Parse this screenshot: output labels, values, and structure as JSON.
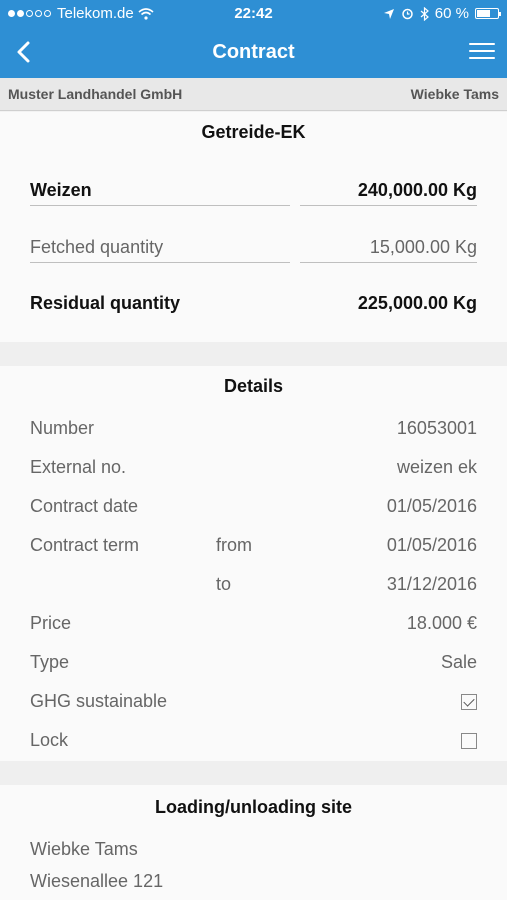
{
  "status": {
    "carrier": "Telekom.de",
    "time": "22:42",
    "battery": "60 %"
  },
  "nav": {
    "title": "Contract"
  },
  "customer": {
    "company": "Muster Landhandel GmbH",
    "person": "Wiebke Tams"
  },
  "summary": {
    "title": "Getreide-EK",
    "product": "Weizen",
    "total_qty": "240,000.00 Kg",
    "fetched_label": "Fetched quantity",
    "fetched_qty": "15,000.00 Kg",
    "residual_label": "Residual quantity",
    "residual_qty": "225,000.00 Kg"
  },
  "details": {
    "title": "Details",
    "number_label": "Number",
    "number_value": "16053001",
    "external_label": "External no.",
    "external_value": "weizen ek",
    "contract_date_label": "Contract date",
    "contract_date_value": "01/05/2016",
    "term_label": "Contract term",
    "term_from_label": "from",
    "term_from_value": "01/05/2016",
    "term_to_label": "to",
    "term_to_value": "31/12/2016",
    "price_label": "Price",
    "price_value": "18.000 €",
    "type_label": "Type",
    "type_value": "Sale",
    "ghg_label": "GHG sustainable",
    "ghg_checked": true,
    "lock_label": "Lock",
    "lock_checked": false
  },
  "site": {
    "title": "Loading/unloading site",
    "name": "Wiebke Tams",
    "street": "Wiesenallee 121"
  }
}
